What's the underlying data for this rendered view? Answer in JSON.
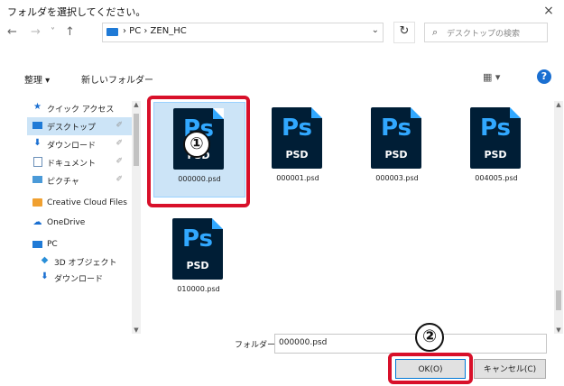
{
  "dialog": {
    "title": "フォルダを選択してください。",
    "close_label": "×"
  },
  "nav_buttons": {
    "back": "←",
    "forward": "→",
    "recent": "˅",
    "up": "↑"
  },
  "address": {
    "path": "› PC › ZEN_HC",
    "dropdown": "⌄",
    "refresh": "↻"
  },
  "search": {
    "icon": "search-icon",
    "placeholder": "デスクトップの検索"
  },
  "toolbar": {
    "organize_label": "整理 ▾",
    "new_folder_label": "新しいフォルダー",
    "view_label": "▦ ▾",
    "help_label": "?"
  },
  "sidebar": {
    "items": [
      {
        "label": "クイック アクセス",
        "icon": "star-icon",
        "pinned": false,
        "selected": false
      },
      {
        "label": "デスクトップ",
        "icon": "desktop-icon",
        "pinned": true,
        "selected": true
      },
      {
        "label": "ダウンロード",
        "icon": "download-icon",
        "pinned": true,
        "selected": false
      },
      {
        "label": "ドキュメント",
        "icon": "document-icon",
        "pinned": true,
        "selected": false
      },
      {
        "label": "ピクチャ",
        "icon": "picture-icon",
        "pinned": true,
        "selected": false
      },
      {
        "label": "Creative Cloud Files",
        "icon": "cloud-folder-icon",
        "pinned": false,
        "selected": false
      },
      {
        "label": "OneDrive",
        "icon": "onedrive-icon",
        "pinned": false,
        "selected": false
      },
      {
        "label": "PC",
        "icon": "pc-icon",
        "pinned": false,
        "selected": false
      },
      {
        "label": "3D オブジェクト",
        "icon": "cube-icon",
        "pinned": false,
        "selected": false
      },
      {
        "label": "ダウンロード",
        "icon": "download-icon",
        "pinned": false,
        "selected": false
      }
    ],
    "pin_glyph": "✐"
  },
  "files": [
    {
      "name": "000000.psd",
      "ps_text": "Ps",
      "psd_text": "PSD",
      "selected": true
    },
    {
      "name": "000001.psd",
      "ps_text": "Ps",
      "psd_text": "PSD",
      "selected": false
    },
    {
      "name": "000003.psd",
      "ps_text": "Ps",
      "psd_text": "PSD",
      "selected": false
    },
    {
      "name": "004005.psd",
      "ps_text": "Ps",
      "psd_text": "PSD",
      "selected": false
    },
    {
      "name": "010000.psd",
      "ps_text": "Ps",
      "psd_text": "PSD",
      "selected": false
    }
  ],
  "annotations": {
    "step1": "①",
    "step2": "②"
  },
  "footer": {
    "folder_label": "フォルダー:",
    "folder_value": "000000.psd",
    "ok_label": "OK(O)",
    "cancel_label": "キャンセル(C)"
  },
  "colors": {
    "accent": "#1a6fd1",
    "selection": "#cce4f7",
    "annotation_red": "#d8102a",
    "ps_bg": "#001e36",
    "ps_text": "#31a8ff"
  }
}
